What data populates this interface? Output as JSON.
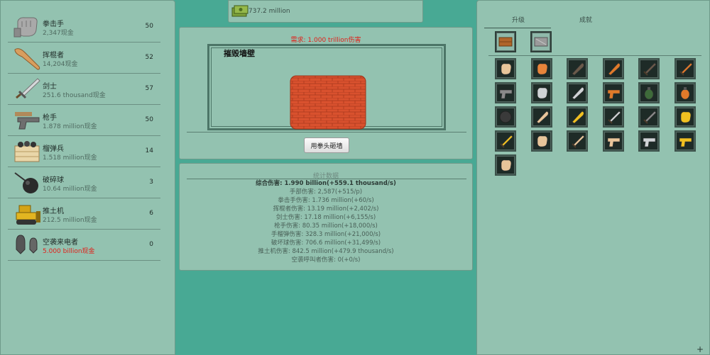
{
  "units": [
    {
      "name": "拳击手",
      "cost": "2,347现金",
      "count": "50",
      "icon": "fist-icon",
      "cost_color": "normal"
    },
    {
      "name": "挥棍者",
      "cost": "14,204现金",
      "count": "52",
      "icon": "club-icon",
      "cost_color": "normal"
    },
    {
      "name": "剑士",
      "cost": "251.6 thousand现金",
      "count": "57",
      "icon": "sword-icon",
      "cost_color": "normal"
    },
    {
      "name": "枪手",
      "cost": "1.878 million现金",
      "count": "50",
      "icon": "gun-icon",
      "cost_color": "normal"
    },
    {
      "name": "榴弹兵",
      "cost": "1.518 million现金",
      "count": "14",
      "icon": "grenade-crate-icon",
      "cost_color": "normal"
    },
    {
      "name": "破碎球",
      "cost": "10.64 million现金",
      "count": "3",
      "icon": "wrecking-ball-icon",
      "cost_color": "normal"
    },
    {
      "name": "推土机",
      "cost": "212.5 million现金",
      "count": "6",
      "icon": "bulldozer-icon",
      "cost_color": "normal"
    },
    {
      "name": "空袭来电者",
      "cost": "5.000 billion现金",
      "count": "0",
      "icon": "airstrike-bombs-icon",
      "cost_color": "red"
    }
  ],
  "money": {
    "amount": "737.2 million",
    "icon": "cash-stack-icon"
  },
  "wall": {
    "requirement": "需求:   1.000 trillion伤害",
    "title": "摧毁墙壁",
    "button": "用拳头砸墙",
    "icon": "brick-wall-icon"
  },
  "stats": {
    "heading": "统计数据",
    "rows": [
      {
        "text": "综合伤害:   1.990 billion(+559.1 thousand/s)",
        "total": true
      },
      {
        "text": "手部伤害:   2,587(+515/p)",
        "total": false
      },
      {
        "text": "拳击手伤害:   1.736 million(+60/s)",
        "total": false
      },
      {
        "text": "挥棍者伤害:   13.19 million(+2,402/s)",
        "total": false
      },
      {
        "text": "剑士伤害:   17.18 million(+6,155/s)",
        "total": false
      },
      {
        "text": "枪手伤害:   80.35 million(+18,000/s)",
        "total": false
      },
      {
        "text": "手榴弹伤害:   328.3 million(+21,000/s)",
        "total": false
      },
      {
        "text": "破坏球伤害:   706.6 million(+31,499/s)",
        "total": false
      },
      {
        "text": "推土机伤害:   842.5 million(+479.9 thousand/s)",
        "total": false
      },
      {
        "text": "空袭呼叫者伤害:   0(+0/s)",
        "total": false
      }
    ]
  },
  "tabs": {
    "upgrade": "升级",
    "achievements": "成就"
  },
  "owned_items": [
    "wood-plank-icon",
    "metal-plate-icon"
  ],
  "upgrade_grid": [
    "fist-bandage-icon",
    "fist-red-icon",
    "club-dark-icon",
    "club-orange-icon",
    "knife-dark-icon",
    "sword-orange-icon",
    "pistol-icon",
    "fist-white-icon",
    "club-white-icon",
    "pistol-orange-icon",
    "grenade-green-icon",
    "grenade-orange-icon",
    "wrecking-ball-small-icon",
    "fist-clubs-icon",
    "club-yellow-icon",
    "sword-silver-icon",
    "crossed-swords-icon",
    "fist-yellow-icon",
    "sword-gold-icon",
    "double-fist-icon",
    "fist-sword-icon",
    "fist-pistol-icon",
    "pistol-silver-icon",
    "pistol-gold-icon",
    "fist-tan-icon"
  ],
  "corner": "+"
}
